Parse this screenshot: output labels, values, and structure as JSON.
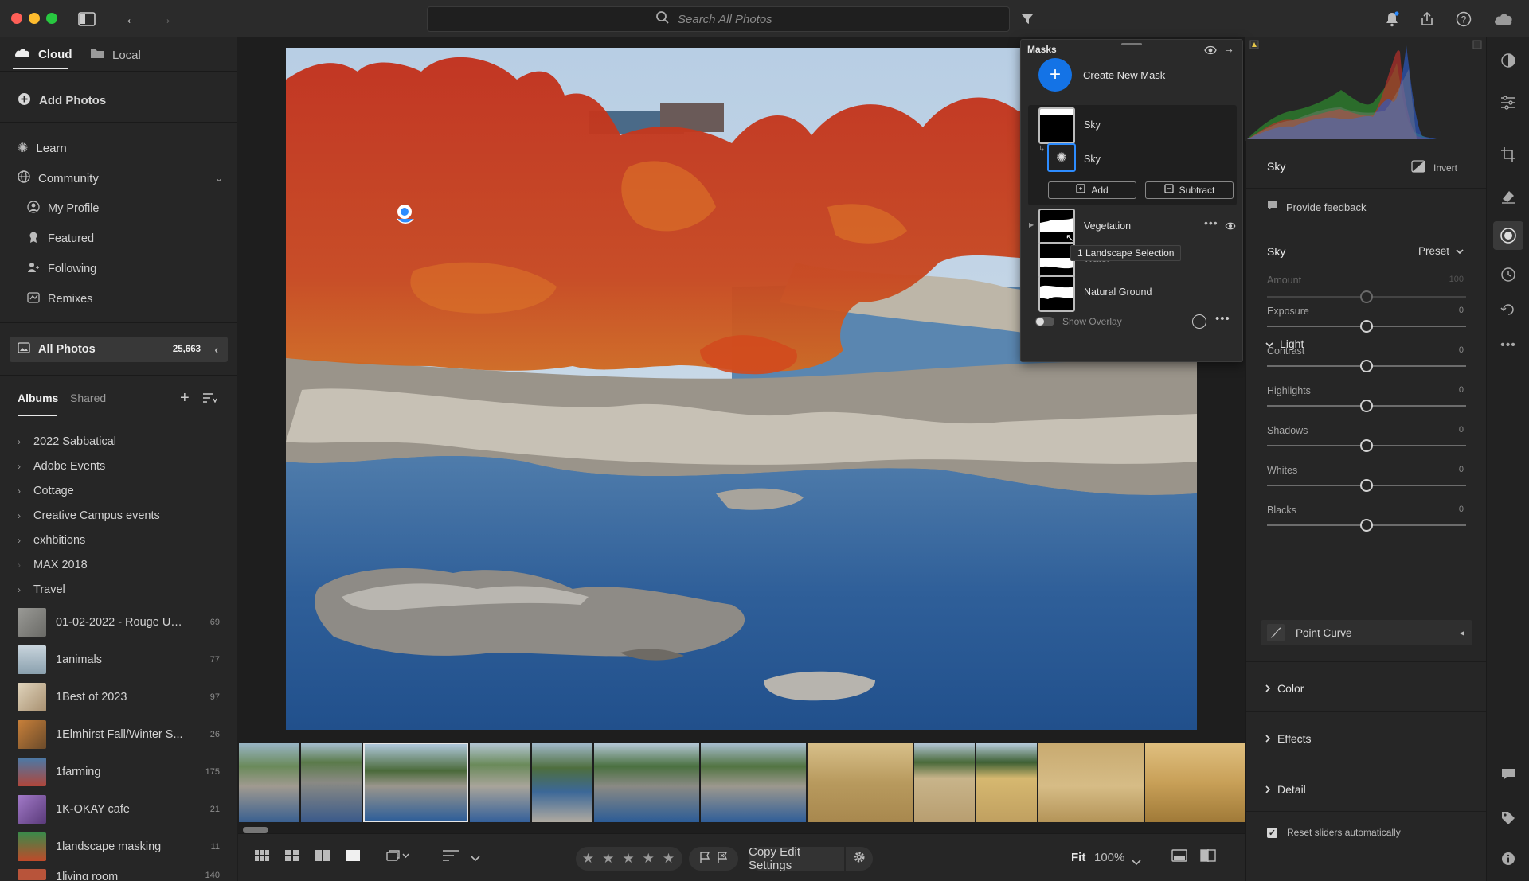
{
  "topbar": {
    "search_placeholder": "Search All Photos"
  },
  "sidebar": {
    "tabs": [
      {
        "label": "Cloud"
      },
      {
        "label": "Local"
      }
    ],
    "add_photos": "Add Photos",
    "learn": "Learn",
    "community": "Community",
    "community_items": [
      {
        "label": "My Profile",
        "icon": "person-icon"
      },
      {
        "label": "Featured",
        "icon": "award-icon"
      },
      {
        "label": "Following",
        "icon": "following-icon"
      },
      {
        "label": "Remixes",
        "icon": "remix-icon"
      }
    ],
    "all_photos": {
      "label": "All Photos",
      "count": "25,663"
    },
    "album_tabs": [
      {
        "label": "Albums"
      },
      {
        "label": "Shared"
      }
    ],
    "folders": [
      {
        "label": "2022 Sabbatical"
      },
      {
        "label": "Adobe Events"
      },
      {
        "label": "Cottage"
      },
      {
        "label": "Creative Campus events"
      },
      {
        "label": "exhbitions"
      },
      {
        "label": "MAX 2018"
      },
      {
        "label": "Travel"
      }
    ],
    "albums": [
      {
        "label": "01-02-2022 - Rouge Ur...",
        "count": "69",
        "color": "#8a8a86"
      },
      {
        "label": "1animals",
        "count": "77",
        "color": "#a8b6c0"
      },
      {
        "label": "1Best of 2023",
        "count": "97",
        "color": "#c8b89a"
      },
      {
        "label": "1Elmhirst Fall/Winter S...",
        "count": "26",
        "color": "#b06a3a"
      },
      {
        "label": "1farming",
        "count": "175",
        "color": "#3a6a8a"
      },
      {
        "label": "1K-OKAY cafe",
        "count": "21",
        "color": "#7a5a9a"
      },
      {
        "label": "1landscape masking",
        "count": "11",
        "color": "#3e7a3a"
      },
      {
        "label": "1living room",
        "count": "140",
        "color": "#b8543a"
      }
    ]
  },
  "masks_panel": {
    "title": "Masks",
    "create_new": "Create New Mask",
    "mask_group": {
      "label": "Sky",
      "component_label": "Sky",
      "add_label": "Add",
      "subtract_label": "Subtract"
    },
    "other_masks": [
      {
        "label": "Vegetation"
      },
      {
        "label": "Water"
      },
      {
        "label": "Natural Ground"
      }
    ],
    "tooltip": "1 Landscape Selection",
    "show_overlay": "Show Overlay"
  },
  "edit_panel": {
    "mask_name": "Sky",
    "invert_label": "Invert",
    "feedback_label": "Provide feedback",
    "preset_section": {
      "title": "Sky",
      "preset_label": "Preset"
    },
    "amount": {
      "label": "Amount",
      "value": "100",
      "position": 0.5
    },
    "light_title": "Light",
    "sliders": [
      {
        "label": "Exposure",
        "value": "0",
        "position": 0.5
      },
      {
        "label": "Contrast",
        "value": "0",
        "position": 0.5
      },
      {
        "label": "Highlights",
        "value": "0",
        "position": 0.5
      },
      {
        "label": "Shadows",
        "value": "0",
        "position": 0.5
      },
      {
        "label": "Whites",
        "value": "0",
        "position": 0.5
      },
      {
        "label": "Blacks",
        "value": "0",
        "position": 0.5
      }
    ],
    "point_curve_label": "Point Curve",
    "sections": [
      {
        "label": "Color"
      },
      {
        "label": "Effects"
      },
      {
        "label": "Detail"
      }
    ],
    "reset_label": "Reset sliders automatically",
    "reset_checked": true
  },
  "bottombar": {
    "copy_edit": "Copy Edit Settings",
    "fit": "Fit",
    "zoom": "100%",
    "stars": [
      "★",
      "★",
      "★",
      "★",
      "★"
    ]
  },
  "colors": {
    "accent": "#1473e6",
    "mask_overlay": "#d2321e"
  }
}
